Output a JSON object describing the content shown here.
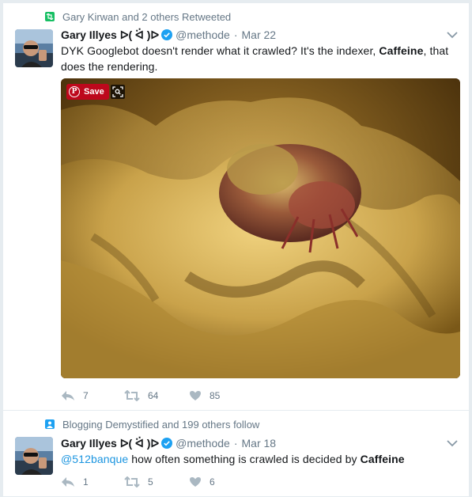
{
  "tweets": [
    {
      "context": "Gary Kirwan and 2 others Retweeted",
      "name": "Gary Illyes ᐅ( ᐛ )ᐅ",
      "handle": "@methode",
      "dot": "·",
      "date": "Mar 22",
      "text_pre": "DYK Googlebot doesn't render what it crawled? It's the indexer, ",
      "text_bold": "Caffeine",
      "text_post": ", that does the rendering.",
      "pin_save": "Save",
      "reply_count": "7",
      "retweet_count": "64",
      "like_count": "85"
    },
    {
      "context": "Blogging Demystified and 199 others follow",
      "name": "Gary Illyes ᐅ( ᐛ )ᐅ",
      "handle": "@methode",
      "dot": "·",
      "date": "Mar 18",
      "mention": "@512banque",
      "text_mid": " how often something is crawled is decided by ",
      "text_bold": "Caffeine",
      "reply_count": "1",
      "retweet_count": "5",
      "like_count": "6"
    }
  ],
  "colors": {
    "retweet_green": "#17bf63",
    "follow_blue": "#1da1f2",
    "verified_blue": "#1da1f2",
    "pinterest_red": "#bd081c",
    "secondary_text": "#657786"
  },
  "icons": {
    "context1": "retweet-icon",
    "context2": "person-icon",
    "verified": "verified-badge-icon",
    "caret": "chevron-down-icon",
    "reply": "reply-icon",
    "retweet": "retweet-icon",
    "like": "heart-icon"
  }
}
